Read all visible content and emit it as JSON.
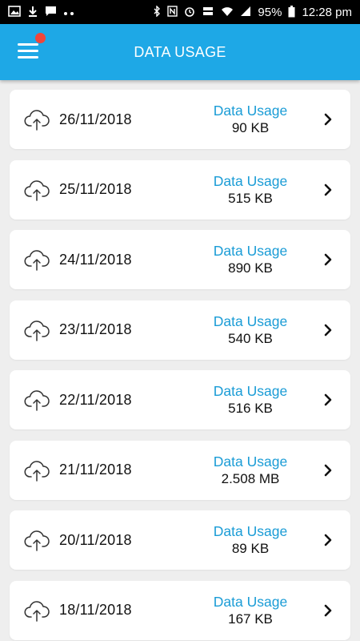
{
  "status_bar": {
    "battery": "95%",
    "time": "12:28 pm"
  },
  "header": {
    "title": "DATA USAGE"
  },
  "records": [
    {
      "date": "26/11/2018",
      "label": "Data Usage",
      "value": "90 KB"
    },
    {
      "date": "25/11/2018",
      "label": "Data Usage",
      "value": "515 KB"
    },
    {
      "date": "24/11/2018",
      "label": "Data Usage",
      "value": "890 KB"
    },
    {
      "date": "23/11/2018",
      "label": "Data Usage",
      "value": "540 KB"
    },
    {
      "date": "22/11/2018",
      "label": "Data Usage",
      "value": "516 KB"
    },
    {
      "date": "21/11/2018",
      "label": "Data Usage",
      "value": "2.508 MB"
    },
    {
      "date": "20/11/2018",
      "label": "Data Usage",
      "value": "89 KB"
    },
    {
      "date": "18/11/2018",
      "label": "Data Usage",
      "value": "167 KB"
    }
  ]
}
